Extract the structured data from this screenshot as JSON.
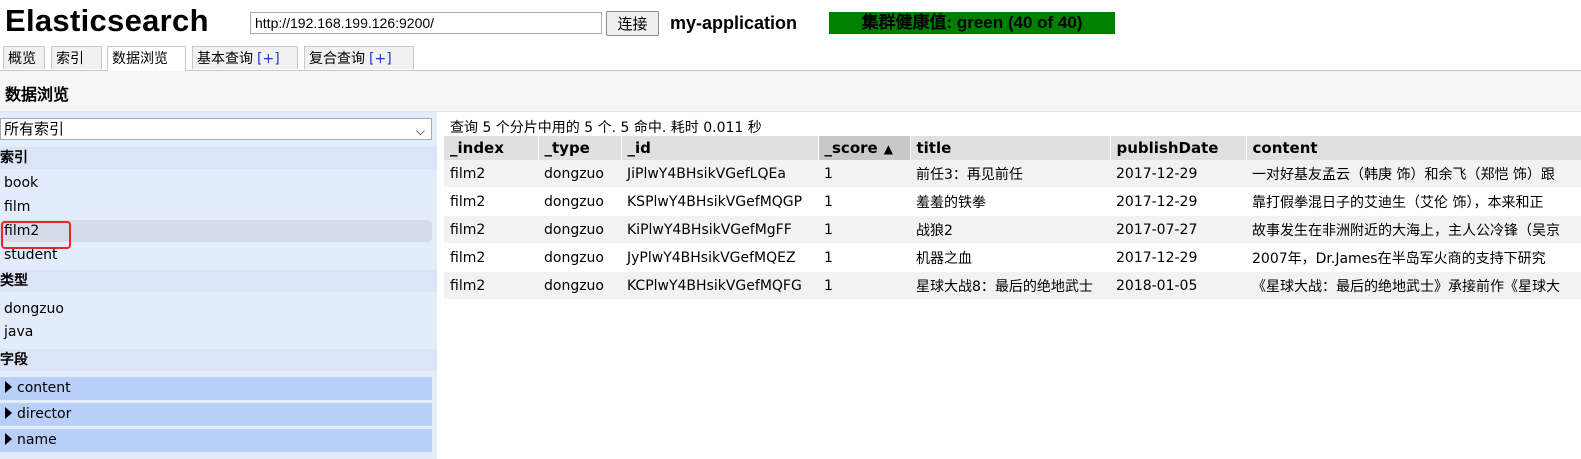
{
  "header": {
    "brand": "Elasticsearch",
    "url_value": "http://192.168.199.126:9200/",
    "connect_label": "连接",
    "cluster_name": "my-application",
    "health_text": "集群健康值: green (40 of 40)",
    "health_color": "#008000"
  },
  "tabs": [
    {
      "label": "概览",
      "plus": ""
    },
    {
      "label": "索引",
      "plus": ""
    },
    {
      "label": "数据浏览",
      "plus": ""
    },
    {
      "label": "基本查询",
      "plus": "[+]"
    },
    {
      "label": "复合查询",
      "plus": "[+]"
    }
  ],
  "active_tab": "数据浏览",
  "section_title": "数据浏览",
  "sidebar": {
    "index_select_value": "所有索引",
    "indices_heading": "索引",
    "indices": [
      "book",
      "film",
      "film2",
      "student"
    ],
    "selected_index": "film2",
    "types_heading": "类型",
    "types": [
      "dongzuo",
      "java"
    ],
    "fields_heading": "字段",
    "fields": [
      "content",
      "director",
      "name"
    ],
    "highlight_color": "#e8262c"
  },
  "results": {
    "summary": "查询 5 个分片中用的 5 个. 5 命中. 耗时 0.011 秒",
    "columns": [
      "_index",
      "_type",
      "_id",
      "_score",
      "title",
      "publishDate",
      "content"
    ],
    "sorted_column": "_score",
    "rows": [
      [
        "film2",
        "dongzuo",
        "JiPlwY4BHsikVGefLQEa",
        "1",
        "前任3：再见前任",
        "2017-12-29",
        "一对好基友孟云（韩庚 饰）和余飞（郑恺 饰）跟"
      ],
      [
        "film2",
        "dongzuo",
        "KSPlwY4BHsikVGefMQGP",
        "1",
        "羞羞的铁拳",
        "2017-12-29",
        "靠打假拳混日子的艾迪生（艾伦 饰），本来和正"
      ],
      [
        "film2",
        "dongzuo",
        "KiPlwY4BHsikVGefMgFF",
        "1",
        "战狼2",
        "2017-07-27",
        "故事发生在非洲附近的大海上，主人公冷锋（吴京"
      ],
      [
        "film2",
        "dongzuo",
        "JyPlwY4BHsikVGefMQEZ",
        "1",
        "机器之血",
        "2017-12-29",
        "2007年，Dr.James在半岛军火商的支持下研究"
      ],
      [
        "film2",
        "dongzuo",
        "KCPlwY4BHsikVGefMQFG",
        "1",
        "星球大战8：最后的绝地武士",
        "2018-01-05",
        "《星球大战：最后的绝地武士》承接前作《星球大"
      ]
    ]
  }
}
